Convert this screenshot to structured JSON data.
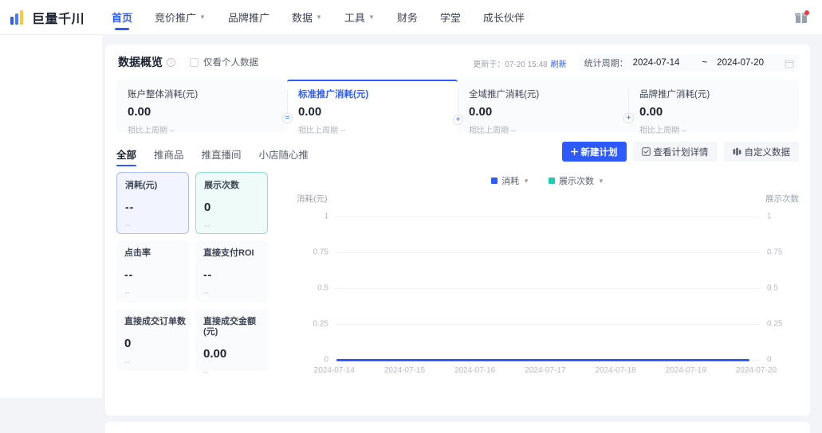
{
  "topnav": {
    "logo_text": "巨量千川",
    "items": [
      {
        "label": "首页",
        "has_caret": false,
        "active": true
      },
      {
        "label": "竞价推广",
        "has_caret": true,
        "active": false
      },
      {
        "label": "品牌推广",
        "has_caret": false,
        "active": false
      },
      {
        "label": "数据",
        "has_caret": true,
        "active": false
      },
      {
        "label": "工具",
        "has_caret": true,
        "active": false
      },
      {
        "label": "财务",
        "has_caret": false,
        "active": false
      },
      {
        "label": "学堂",
        "has_caret": false,
        "active": false
      },
      {
        "label": "成长伙伴",
        "has_caret": false,
        "active": false
      }
    ],
    "gift_icon": "gift-icon"
  },
  "panel": {
    "title": "数据概览",
    "info_icon": "info-circle-icon",
    "personal_only_checkbox": {
      "label": "仅看个人数据",
      "checked": false
    },
    "updated_text": "更新于：07-20 15:48",
    "refresh_label": "刷新",
    "period_label": "统计周期：",
    "period_start": "2024-07-14",
    "period_separator": "~",
    "period_end": "2024-07-20",
    "calendar_icon": "calendar-icon"
  },
  "summary": {
    "cells": [
      {
        "label": "账户整体消耗(元)",
        "value": "0.00",
        "sub": "相比上周期 --",
        "active": false,
        "op": "="
      },
      {
        "label": "标准推广消耗(元)",
        "value": "0.00",
        "sub": "相比上周期 --",
        "active": true,
        "op": "+"
      },
      {
        "label": "全域推广消耗(元)",
        "value": "0.00",
        "sub": "相比上周期 --",
        "active": false,
        "op": "+"
      },
      {
        "label": "品牌推广消耗(元)",
        "value": "0.00",
        "sub": "相比上周期 --",
        "active": false,
        "op": ""
      }
    ]
  },
  "tabs": [
    {
      "label": "全部",
      "active": true
    },
    {
      "label": "推商品",
      "active": false
    },
    {
      "label": "推直播间",
      "active": false
    },
    {
      "label": "小店随心推",
      "active": false
    }
  ],
  "buttons": {
    "new_plan": {
      "label": "新建计划",
      "icon": "plus-icon"
    },
    "view_detail": {
      "label": "查看计划详情",
      "icon": "checkbox-square-icon"
    },
    "custom_data": {
      "label": "自定义数据",
      "icon": "columns-icon"
    }
  },
  "metric_cards": [
    {
      "label": "消耗(元)",
      "value": "--",
      "sub": "--",
      "state": "selected-blue"
    },
    {
      "label": "展示次数",
      "value": "0",
      "sub": "--",
      "state": "selected-teal"
    },
    {
      "label": "点击率",
      "value": "--",
      "sub": "--",
      "state": "default"
    },
    {
      "label": "直接支付ROI",
      "value": "--",
      "sub": "--",
      "state": "default"
    },
    {
      "label": "直接成交订单数",
      "value": "0",
      "sub": "--",
      "state": "default"
    },
    {
      "label": "直接成交金额(元)",
      "value": "0.00",
      "sub": "--",
      "state": "default"
    }
  ],
  "colors": {
    "accent": "#2e5bff",
    "series_consumption": "#2e5bff",
    "series_impressions": "#1ecbb0",
    "page_bg": "#f2f4f7"
  },
  "chart_data": {
    "type": "line",
    "title": "",
    "xlabel": "",
    "ylabel": "消耗(元)",
    "y2label": "展示次数",
    "x": [
      "2024-07-14",
      "2024-07-15",
      "2024-07-16",
      "2024-07-17",
      "2024-07-18",
      "2024-07-19",
      "2024-07-20"
    ],
    "yticks": [
      "0",
      "0.25",
      "0.5",
      "0.75",
      "1"
    ],
    "y2ticks": [
      "0",
      "0.25",
      "0.5",
      "0.75",
      "1"
    ],
    "ylim": [
      0,
      1
    ],
    "y2lim": [
      0,
      1
    ],
    "grid": true,
    "legend_position": "top-center",
    "series": [
      {
        "name": "消耗",
        "color": "#2e5bff",
        "axis": "left",
        "values": [
          0,
          0,
          0,
          0,
          0,
          0,
          0
        ]
      },
      {
        "name": "展示次数",
        "color": "#1ecbb0",
        "axis": "right",
        "values": [
          0,
          0,
          0,
          0,
          0,
          0,
          0
        ]
      }
    ]
  }
}
